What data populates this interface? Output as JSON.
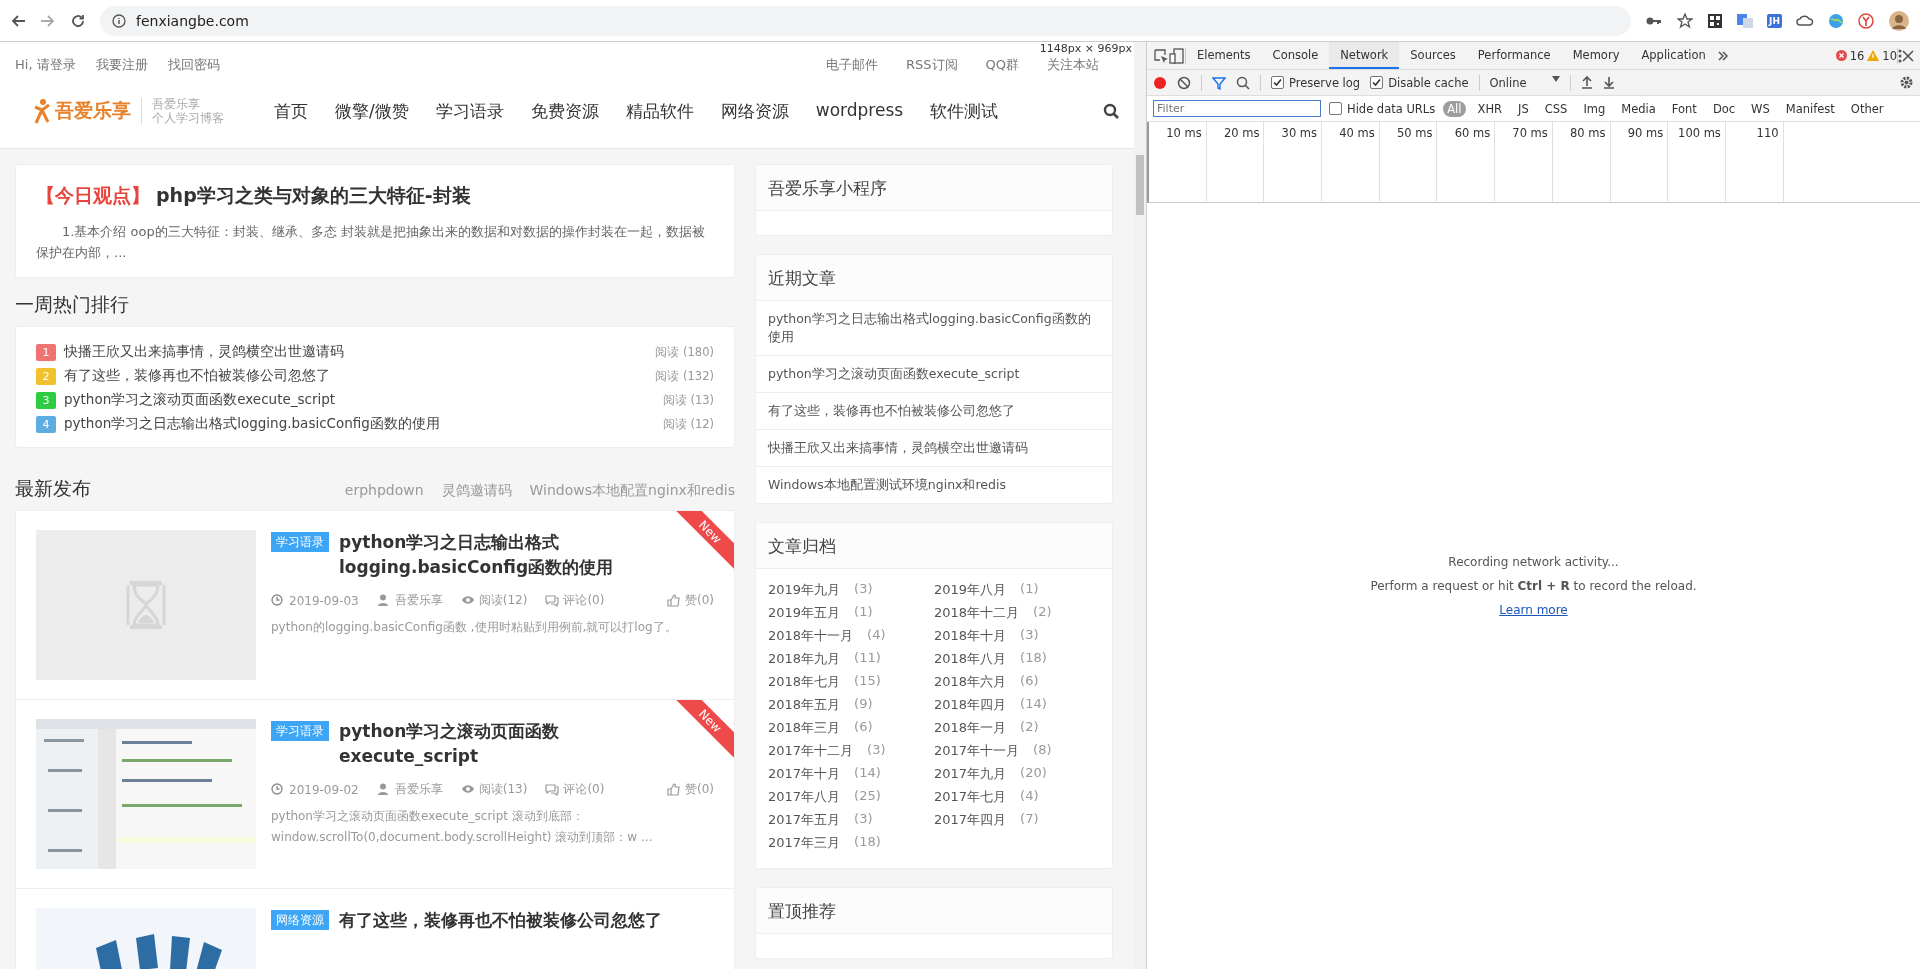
{
  "browser": {
    "url": "fenxiangbe.com",
    "extension_label": "JH"
  },
  "site": {
    "top_links_left": [
      "Hi, 请登录",
      "我要注册",
      "找回密码"
    ],
    "top_links_right": [
      "电子邮件",
      "RSS订阅",
      "QQ群",
      "关注本站"
    ],
    "viewport_size": "1148px × 969px",
    "logo": {
      "name": "吾爱乐享",
      "tagline_1": "吾爱乐享",
      "tagline_2": "个人学习博客"
    },
    "nav": [
      "首页",
      "微擎/微赞",
      "学习语录",
      "免费资源",
      "精品软件",
      "网络资源",
      "wordpress",
      "软件测试"
    ],
    "today": {
      "tag": "【今日观点】",
      "title": "php学习之类与对象的三大特征-封装",
      "excerpt": "1.基本介绍 oop的三大特征：封装、继承、多态 封装就是把抽象出来的数据和对数据的操作封装在一起，数据被保护在内部，..."
    },
    "hot": {
      "title": "一周热门排行",
      "items": [
        {
          "rank": "1",
          "color": "#f07373",
          "title": "快播王欣又出来搞事情，灵鸽横空出世邀请码",
          "reads": "阅读 (180)"
        },
        {
          "rank": "2",
          "color": "#f2c12e",
          "title": "有了这些，装修再也不怕被装修公司忽悠了",
          "reads": "阅读 (132)"
        },
        {
          "rank": "3",
          "color": "#2ecc40",
          "title": "python学习之滚动页面函数execute_script",
          "reads": "阅读 (13)"
        },
        {
          "rank": "4",
          "color": "#5dade2",
          "title": "python学习之日志输出格式logging.basicConfig函数的使用",
          "reads": "阅读 (12)"
        }
      ]
    },
    "latest": {
      "title": "最新发布",
      "tags": [
        "erphpdown",
        "灵鸽邀请码",
        "Windows本地配置nginx和redis"
      ],
      "posts": [
        {
          "thumb": {
            "kind": "placeholder"
          },
          "category": "学习语录",
          "title": "python学习之日志输出格式logging.basicConfig函数的使用",
          "ribbon": "New",
          "date": "2019-09-03",
          "author": "吾爱乐享",
          "views": "阅读(12)",
          "comments": "评论(0)",
          "likes": "赞(0)",
          "excerpt": "python的logging.basicConfig函数 ,使用时粘贴到用例前,就可以打log了。"
        },
        {
          "category": "学习语录",
          "title": "python学习之滚动页面函数execute_script",
          "ribbon": "New",
          "date": "2019-09-02",
          "author": "吾爱乐享",
          "views": "阅读(13)",
          "comments": "评论(0)",
          "likes": "赞(0)",
          "excerpt": "python学习之滚动页面函数execute_script 滚动到底部：window.scrollTo(0,document.body.scrollHeight) 滚动到顶部：w ..."
        },
        {
          "category": "网络资源",
          "title": "有了这些，装修再也不怕被装修公司忽悠了"
        }
      ]
    }
  },
  "sidebar": [
    {
      "kind": "empty",
      "title": "吾爱乐享小程序"
    },
    {
      "kind": "list",
      "title": "近期文章",
      "items": [
        "python学习之日志输出格式logging.basicConfig函数的使用",
        "python学习之滚动页面函数execute_script",
        "有了这些，装修再也不怕被装修公司忽悠了",
        "快播王欣又出来搞事情，灵鸽横空出世邀请码",
        "Windows本地配置测试环境nginx和redis"
      ]
    },
    {
      "kind": "archive",
      "title": "文章归档",
      "items": [
        {
          "month": "2019年九月",
          "count": "(3)"
        },
        {
          "month": "2019年八月",
          "count": "(1)"
        },
        {
          "month": "2019年五月",
          "count": "(1)"
        },
        {
          "month": "2018年十二月",
          "count": "(2)"
        },
        {
          "month": "2018年十一月",
          "count": "(4)"
        },
        {
          "month": "2018年十月",
          "count": "(3)"
        },
        {
          "month": "2018年九月",
          "count": "(11)"
        },
        {
          "month": "2018年八月",
          "count": "(18)"
        },
        {
          "month": "2018年七月",
          "count": "(15)"
        },
        {
          "month": "2018年六月",
          "count": "(6)"
        },
        {
          "month": "2018年五月",
          "count": "(9)"
        },
        {
          "month": "2018年四月",
          "count": "(14)"
        },
        {
          "month": "2018年三月",
          "count": "(6)"
        },
        {
          "month": "2018年一月",
          "count": "(2)"
        },
        {
          "month": "2017年十二月",
          "count": "(3)"
        },
        {
          "month": "2017年十一月",
          "count": "(8)"
        },
        {
          "month": "2017年十月",
          "count": "(14)"
        },
        {
          "month": "2017年九月",
          "count": "(20)"
        },
        {
          "month": "2017年八月",
          "count": "(25)"
        },
        {
          "month": "2017年七月",
          "count": "(4)"
        },
        {
          "month": "2017年五月",
          "count": "(3)"
        },
        {
          "month": "2017年四月",
          "count": "(7)"
        },
        {
          "month": "2017年三月",
          "count": "(18)"
        }
      ]
    },
    {
      "kind": "empty",
      "title": "置顶推荐"
    }
  ],
  "devtools": {
    "tabs": [
      {
        "label": "Elements",
        "selected": false
      },
      {
        "label": "Console",
        "selected": false
      },
      {
        "label": "Network",
        "selected": true
      },
      {
        "label": "Sources",
        "selected": false
      },
      {
        "label": "Performance",
        "selected": false
      },
      {
        "label": "Memory",
        "selected": false
      },
      {
        "label": "Application",
        "selected": false
      }
    ],
    "errors": "16",
    "warnings": "10",
    "preserve_log": {
      "label": "Preserve log",
      "checked": true
    },
    "disable_cache": {
      "label": "Disable cache",
      "checked": true
    },
    "throttle": "Online",
    "filter_placeholder": "Filter",
    "hide_data_urls": {
      "label": "Hide data URLs",
      "checked": false
    },
    "types": [
      {
        "label": "All",
        "selected": true
      },
      {
        "label": "XHR",
        "selected": false
      },
      {
        "label": "JS",
        "selected": false
      },
      {
        "label": "CSS",
        "selected": false
      },
      {
        "label": "Img",
        "selected": false
      },
      {
        "label": "Media",
        "selected": false
      },
      {
        "label": "Font",
        "selected": false
      },
      {
        "label": "Doc",
        "selected": false
      },
      {
        "label": "WS",
        "selected": false
      },
      {
        "label": "Manifest",
        "selected": false
      },
      {
        "label": "Other",
        "selected": false
      }
    ],
    "ticks": [
      "10 ms",
      "20 ms",
      "30 ms",
      "40 ms",
      "50 ms",
      "60 ms",
      "70 ms",
      "80 ms",
      "90 ms",
      "100 ms",
      "110"
    ],
    "message": {
      "status": "Recording network activity...",
      "hint": "Perform a request or hit **Ctrl + R** to record the reload.",
      "link": "Learn more"
    }
  }
}
